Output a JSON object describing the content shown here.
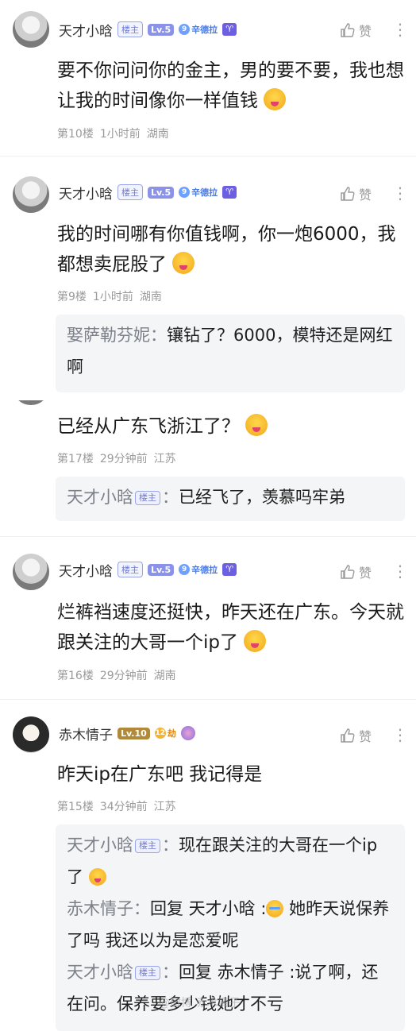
{
  "posts": [
    {
      "username": "天才小晗",
      "badge": "楼主",
      "level": "Lv.5",
      "wealth_num": "9",
      "wealth_label": "辛德拉",
      "zodiac_icon": "aries-icon",
      "like_label": "赞",
      "text": "要不你问问你的金主，男的要不要，我也想让我的时间像你一样值钱",
      "floor": "第10楼",
      "time": "1小时前",
      "location": "湖南"
    },
    {
      "username": "天才小晗",
      "badge": "楼主",
      "level": "Lv.5",
      "wealth_num": "9",
      "wealth_label": "辛德拉",
      "zodiac_icon": "aries-icon",
      "like_label": "赞",
      "text": "我的时间哪有你值钱啊，你一炮6000，我都想卖屁股了",
      "floor": "第9楼",
      "time": "1小时前",
      "location": "湖南",
      "quote": {
        "name": "娶萨勒芬妮",
        "text": "镶钻了？6000，模特还是网红啊"
      }
    },
    {
      "text": "已经从广东飞浙江了？",
      "floor": "第17楼",
      "time": "29分钟前",
      "location": "江苏",
      "quote": {
        "name": "天才小晗",
        "badge": "楼主",
        "text": "已经飞了，羡慕吗牢弟"
      }
    },
    {
      "username": "天才小晗",
      "badge": "楼主",
      "level": "Lv.5",
      "wealth_num": "9",
      "wealth_label": "辛德拉",
      "zodiac_icon": "aries-icon",
      "like_label": "赞",
      "text": "烂裤裆速度还挺快，昨天还在广东。今天就跟关注的大哥一个ip了",
      "floor": "第16楼",
      "time": "29分钟前",
      "location": "湖南"
    },
    {
      "username": "赤木情子",
      "level": "Lv.10",
      "wealth_num": "12",
      "wealth_label": "劫",
      "like_label": "赞",
      "text": "昨天ip在广东吧 我记得是",
      "floor": "第15楼",
      "time": "34分钟前",
      "location": "江苏",
      "quotes": [
        {
          "name": "天才小晗",
          "badge": "楼主",
          "text": "现在跟关注的大哥在一个ip了"
        },
        {
          "name": "赤木情子",
          "text": "回复 天才小晗 :",
          "text2": "她昨天说保养了吗 我还以为是恋爱呢"
        },
        {
          "name": "天才小晗",
          "badge": "楼主",
          "text": "回复 赤木情子 :说了啊，还在问。保养要多少钱她才不亏"
        }
      ]
    }
  ],
  "watermark": "@微博 赤木情子"
}
